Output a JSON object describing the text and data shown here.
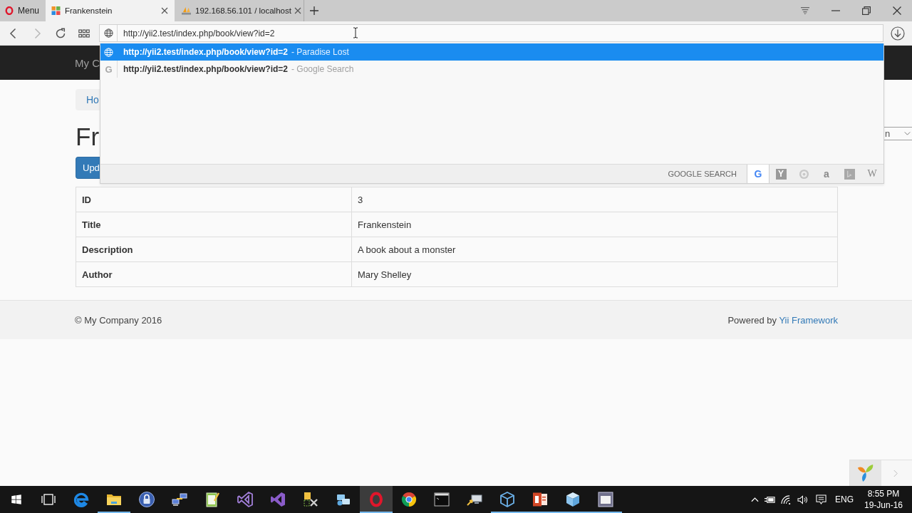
{
  "browser": {
    "menu_label": "Menu",
    "tabs": [
      {
        "kind": "squares",
        "title": "Frankenstein",
        "selected": true
      },
      {
        "kind": "sail",
        "title": "192.168.56.101 / localhost",
        "selected": false
      }
    ],
    "nav_buttons": [
      {
        "kind": "back",
        "disabled": false
      },
      {
        "kind": "forward",
        "disabled": true
      },
      {
        "kind": "reload",
        "disabled": false
      },
      {
        "kind": "grid",
        "disabled": false
      }
    ],
    "address": {
      "value": "http://yii2.test/index.php/book/view?id=2"
    },
    "suggestions": [
      {
        "kind": "page",
        "url": "http://yii2.test/index.php/book/view?id=2",
        "detail": "- Paradise Lost",
        "selected": true
      },
      {
        "kind": "search",
        "glyph": "G",
        "url": "http://yii2.test/index.php/book/view?id=2",
        "detail": "- Google Search",
        "selected": false
      }
    ],
    "search_bar": {
      "label": "GOOGLE SEARCH",
      "engines": [
        {
          "kind": "letter",
          "glyph": "G",
          "selected": true
        },
        {
          "kind": "tile",
          "glyph": "Y",
          "selected": false
        },
        {
          "kind": "ring",
          "selected": false
        },
        {
          "kind": "letter",
          "glyph": "a",
          "selected": false
        },
        {
          "kind": "square",
          "selected": false
        },
        {
          "kind": "serif",
          "glyph": "W",
          "selected": false
        }
      ]
    }
  },
  "page": {
    "brand": "My C",
    "breadcrumb": "Ho",
    "heading": "Fr",
    "select_value": "n",
    "button": "Upd",
    "table": {
      "rows": [
        {
          "label": "ID",
          "value": "3"
        },
        {
          "label": "Title",
          "value": "Frankenstein"
        },
        {
          "label": "Description",
          "value": "A book about a monster"
        },
        {
          "label": "Author",
          "value": "Mary Shelley"
        }
      ]
    },
    "footer": {
      "copyright": "© My Company 2016",
      "powered_by": "Powered by",
      "link": "Yii Framework"
    }
  },
  "taskbar": {
    "apps": [
      {
        "kind": "four-panes",
        "running": false,
        "selected": false
      },
      {
        "kind": "task-view",
        "running": false,
        "selected": false
      },
      {
        "kind": "e-logo",
        "running": false,
        "selected": false
      },
      {
        "kind": "folder",
        "running": true,
        "selected": false
      },
      {
        "kind": "padlock",
        "running": false,
        "selected": false
      },
      {
        "kind": "network-computers",
        "running": false,
        "selected": false
      },
      {
        "kind": "notepad",
        "running": false,
        "selected": false
      },
      {
        "kind": "ribbon-outline",
        "running": false,
        "selected": false
      },
      {
        "kind": "ribbon-filled",
        "running": false,
        "selected": false
      },
      {
        "kind": "tools",
        "running": false,
        "selected": false
      },
      {
        "kind": "computers",
        "running": false,
        "selected": false
      },
      {
        "kind": "ring-logo",
        "running": true,
        "selected": true
      },
      {
        "kind": "tricolor-circle",
        "running": false,
        "selected": false
      },
      {
        "kind": "terminal",
        "running": false,
        "selected": false
      },
      {
        "kind": "monitor-arrow",
        "running": false,
        "selected": false
      },
      {
        "kind": "cube-outline",
        "running": true,
        "selected": false
      },
      {
        "kind": "slides",
        "running": true,
        "selected": false
      },
      {
        "kind": "cube",
        "running": true,
        "selected": false
      },
      {
        "kind": "window",
        "running": true,
        "selected": false
      }
    ],
    "tray": {
      "language": "ENG",
      "time": "8:55 PM",
      "date": "19-Jun-16"
    }
  }
}
